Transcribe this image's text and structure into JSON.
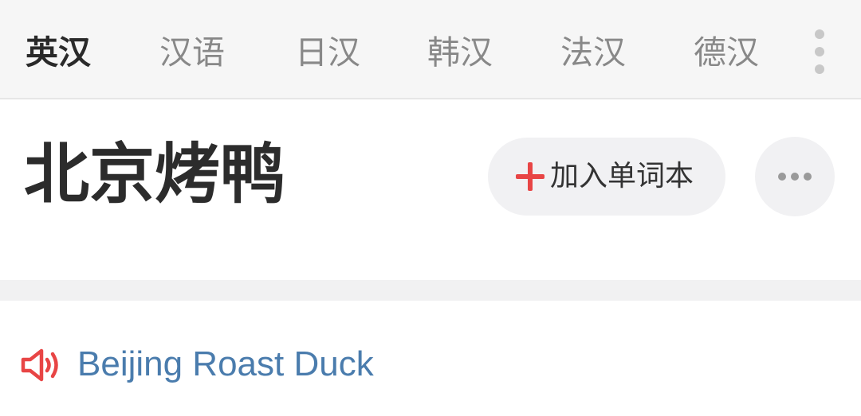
{
  "tabs": [
    {
      "label": "英汉",
      "active": true
    },
    {
      "label": "汉语",
      "active": false
    },
    {
      "label": "日汉",
      "active": false
    },
    {
      "label": "韩汉",
      "active": false
    },
    {
      "label": "法汉",
      "active": false
    },
    {
      "label": "德汉",
      "active": false
    }
  ],
  "tab_more_icon": "vertical-ellipsis-icon",
  "word": {
    "title": "北京烤鸭"
  },
  "actions": {
    "add_label": "加入单词本",
    "add_icon": "plus-icon",
    "more_icon": "horizontal-ellipsis-icon"
  },
  "translation": {
    "text": "Beijing Roast Duck",
    "icon": "speaker-icon"
  },
  "colors": {
    "accent_red": "#e84545",
    "link_blue": "#4a7cad",
    "tab_bar_bg": "#f6f6f6",
    "button_bg": "#f1f1f3"
  }
}
